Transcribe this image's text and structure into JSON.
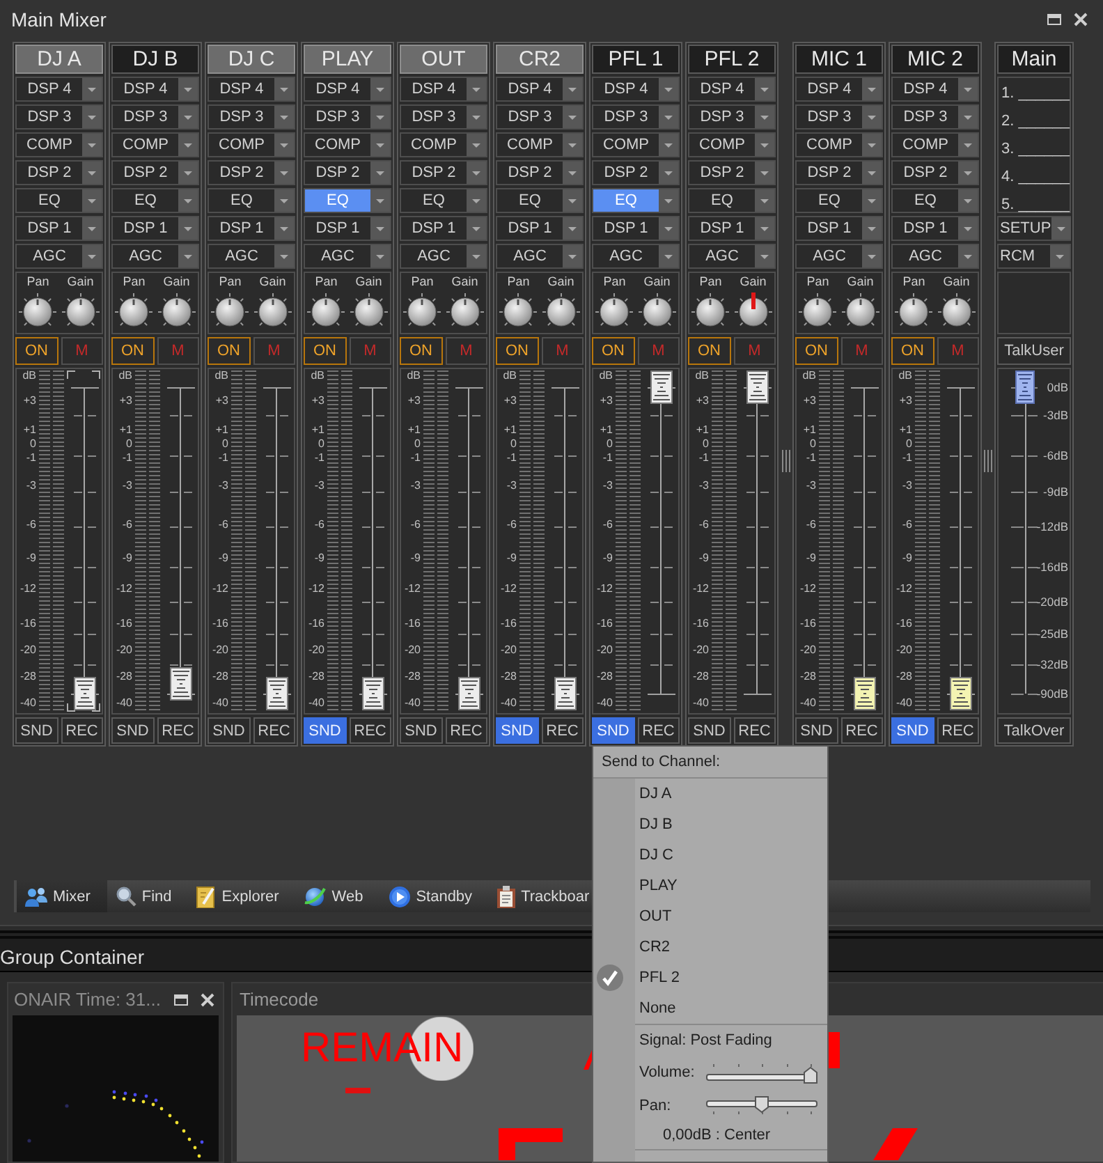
{
  "window": {
    "title": "Main Mixer"
  },
  "groups": [
    {
      "channels": [
        {
          "name": "DJ A",
          "kind": "line",
          "lit": true,
          "slots": [
            {
              "label": "DSP 4",
              "active": false
            },
            {
              "label": "DSP 3",
              "active": false
            },
            {
              "label": "COMP",
              "active": false
            },
            {
              "label": "DSP 2",
              "active": false
            },
            {
              "label": "EQ",
              "active": false
            },
            {
              "label": "DSP 1",
              "active": false
            },
            {
              "label": "AGC",
              "active": false
            }
          ],
          "knobs": [
            {
              "label": "Pan",
              "level": 0.5,
              "highlighted": false
            },
            {
              "label": "Gain",
              "level": 0.5,
              "highlighted": false
            }
          ],
          "on_label": "ON",
          "mute_label": "M",
          "scale": [
            "dB",
            "+3",
            "+1",
            "0",
            "-1",
            "-3",
            "-6",
            "-9",
            "-12",
            "-16",
            "-20",
            "-28",
            "-40"
          ],
          "fader": {
            "level": 0,
            "focused": true
          },
          "send": {
            "label": "SND",
            "on": false
          },
          "rec_label": "REC"
        },
        {
          "name": "DJ B",
          "kind": "line",
          "lit": false,
          "slots": [
            {
              "label": "DSP 4",
              "active": false
            },
            {
              "label": "DSP 3",
              "active": false
            },
            {
              "label": "COMP",
              "active": false
            },
            {
              "label": "DSP 2",
              "active": false
            },
            {
              "label": "EQ",
              "active": false
            },
            {
              "label": "DSP 1",
              "active": false
            },
            {
              "label": "AGC",
              "active": false
            }
          ],
          "knobs": [
            {
              "label": "Pan",
              "level": 0.5,
              "highlighted": false
            },
            {
              "label": "Gain",
              "level": 0.5,
              "highlighted": false
            }
          ],
          "on_label": "ON",
          "mute_label": "M",
          "scale": [
            "dB",
            "+3",
            "+1",
            "0",
            "-1",
            "-3",
            "-6",
            "-9",
            "-12",
            "-16",
            "-20",
            "-28",
            "-40"
          ],
          "fader": {
            "level": 0.03,
            "focused": false
          },
          "send": {
            "label": "SND",
            "on": false
          },
          "rec_label": "REC"
        },
        {
          "name": "DJ C",
          "kind": "line",
          "lit": true,
          "slots": [
            {
              "label": "DSP 4",
              "active": false
            },
            {
              "label": "DSP 3",
              "active": false
            },
            {
              "label": "COMP",
              "active": false
            },
            {
              "label": "DSP 2",
              "active": false
            },
            {
              "label": "EQ",
              "active": false
            },
            {
              "label": "DSP 1",
              "active": false
            },
            {
              "label": "AGC",
              "active": false
            }
          ],
          "knobs": [
            {
              "label": "Pan",
              "level": 0.5,
              "highlighted": false
            },
            {
              "label": "Gain",
              "level": 0.5,
              "highlighted": false
            }
          ],
          "on_label": "ON",
          "mute_label": "M",
          "scale": [
            "dB",
            "+3",
            "+1",
            "0",
            "-1",
            "-3",
            "-6",
            "-9",
            "-12",
            "-16",
            "-20",
            "-28",
            "-40"
          ],
          "fader": {
            "level": 0,
            "focused": false
          },
          "send": {
            "label": "SND",
            "on": false
          },
          "rec_label": "REC"
        },
        {
          "name": "PLAY",
          "kind": "line",
          "lit": true,
          "slots": [
            {
              "label": "DSP 4",
              "active": false
            },
            {
              "label": "DSP 3",
              "active": false
            },
            {
              "label": "COMP",
              "active": false
            },
            {
              "label": "DSP 2",
              "active": false
            },
            {
              "label": "EQ",
              "active": true
            },
            {
              "label": "DSP 1",
              "active": false
            },
            {
              "label": "AGC",
              "active": false
            }
          ],
          "knobs": [
            {
              "label": "Pan",
              "level": 0.5,
              "highlighted": false
            },
            {
              "label": "Gain",
              "level": 0.5,
              "highlighted": false
            }
          ],
          "on_label": "ON",
          "mute_label": "M",
          "scale": [
            "dB",
            "+3",
            "+1",
            "0",
            "-1",
            "-3",
            "-6",
            "-9",
            "-12",
            "-16",
            "-20",
            "-28",
            "-40"
          ],
          "fader": {
            "level": 0,
            "focused": false
          },
          "send": {
            "label": "SND",
            "on": true
          },
          "rec_label": "REC"
        },
        {
          "name": "OUT",
          "kind": "line",
          "lit": true,
          "slots": [
            {
              "label": "DSP 4",
              "active": false
            },
            {
              "label": "DSP 3",
              "active": false
            },
            {
              "label": "COMP",
              "active": false
            },
            {
              "label": "DSP 2",
              "active": false
            },
            {
              "label": "EQ",
              "active": false
            },
            {
              "label": "DSP 1",
              "active": false
            },
            {
              "label": "AGC",
              "active": false
            }
          ],
          "knobs": [
            {
              "label": "Pan",
              "level": 0.5,
              "highlighted": false
            },
            {
              "label": "Gain",
              "level": 0.5,
              "highlighted": false
            }
          ],
          "on_label": "ON",
          "mute_label": "M",
          "scale": [
            "dB",
            "+3",
            "+1",
            "0",
            "-1",
            "-3",
            "-6",
            "-9",
            "-12",
            "-16",
            "-20",
            "-28",
            "-40"
          ],
          "fader": {
            "level": 0,
            "focused": false
          },
          "send": {
            "label": "SND",
            "on": false
          },
          "rec_label": "REC"
        },
        {
          "name": "CR2",
          "kind": "line",
          "lit": true,
          "slots": [
            {
              "label": "DSP 4",
              "active": false
            },
            {
              "label": "DSP 3",
              "active": false
            },
            {
              "label": "COMP",
              "active": false
            },
            {
              "label": "DSP 2",
              "active": false
            },
            {
              "label": "EQ",
              "active": false
            },
            {
              "label": "DSP 1",
              "active": false
            },
            {
              "label": "AGC",
              "active": false
            }
          ],
          "knobs": [
            {
              "label": "Pan",
              "level": 0.5,
              "highlighted": false
            },
            {
              "label": "Gain",
              "level": 0.5,
              "highlighted": false
            }
          ],
          "on_label": "ON",
          "mute_label": "M",
          "scale": [
            "dB",
            "+3",
            "+1",
            "0",
            "-1",
            "-3",
            "-6",
            "-9",
            "-12",
            "-16",
            "-20",
            "-28",
            "-40"
          ],
          "fader": {
            "level": 0,
            "focused": false
          },
          "send": {
            "label": "SND",
            "on": true
          },
          "rec_label": "REC"
        },
        {
          "name": "PFL 1",
          "kind": "line",
          "lit": false,
          "slots": [
            {
              "label": "DSP 4",
              "active": false
            },
            {
              "label": "DSP 3",
              "active": false
            },
            {
              "label": "COMP",
              "active": false
            },
            {
              "label": "DSP 2",
              "active": false
            },
            {
              "label": "EQ",
              "active": true
            },
            {
              "label": "DSP 1",
              "active": false
            },
            {
              "label": "AGC",
              "active": false
            }
          ],
          "knobs": [
            {
              "label": "Pan",
              "level": 0.5,
              "highlighted": false
            },
            {
              "label": "Gain",
              "level": 0.5,
              "highlighted": false
            }
          ],
          "on_label": "ON",
          "mute_label": "M",
          "scale": [
            "dB",
            "+3",
            "+1",
            "0",
            "-1",
            "-3",
            "-6",
            "-9",
            "-12",
            "-16",
            "-20",
            "-28",
            "-40"
          ],
          "fader": {
            "level": 1,
            "focused": false
          },
          "send": {
            "label": "SND",
            "on": true
          },
          "rec_label": "REC"
        },
        {
          "name": "PFL 2",
          "kind": "line",
          "lit": false,
          "slots": [
            {
              "label": "DSP 4",
              "active": false
            },
            {
              "label": "DSP 3",
              "active": false
            },
            {
              "label": "COMP",
              "active": false
            },
            {
              "label": "DSP 2",
              "active": false
            },
            {
              "label": "EQ",
              "active": false
            },
            {
              "label": "DSP 1",
              "active": false
            },
            {
              "label": "AGC",
              "active": false
            }
          ],
          "knobs": [
            {
              "label": "Pan",
              "level": 0.5,
              "highlighted": false
            },
            {
              "label": "Gain",
              "level": 0.5,
              "highlighted": true
            }
          ],
          "on_label": "ON",
          "mute_label": "M",
          "scale": [
            "dB",
            "+3",
            "+1",
            "0",
            "-1",
            "-3",
            "-6",
            "-9",
            "-12",
            "-16",
            "-20",
            "-28",
            "-40"
          ],
          "fader": {
            "level": 1,
            "focused": false
          },
          "send": {
            "label": "SND",
            "on": false
          },
          "rec_label": "REC"
        }
      ]
    },
    {
      "channels": [
        {
          "name": "MIC 1",
          "kind": "mic",
          "lit": false,
          "slots": [
            {
              "label": "DSP 4",
              "active": false
            },
            {
              "label": "DSP 3",
              "active": false
            },
            {
              "label": "COMP",
              "active": false
            },
            {
              "label": "DSP 2",
              "active": false
            },
            {
              "label": "EQ",
              "active": false
            },
            {
              "label": "DSP 1",
              "active": false
            },
            {
              "label": "AGC",
              "active": false
            }
          ],
          "knobs": [
            {
              "label": "Pan",
              "level": 0.5,
              "highlighted": false
            },
            {
              "label": "Gain",
              "level": 0.5,
              "highlighted": false
            }
          ],
          "on_label": "ON",
          "mute_label": "M",
          "scale": [
            "dB",
            "+3",
            "+1",
            "0",
            "-1",
            "-3",
            "-6",
            "-9",
            "-12",
            "-16",
            "-20",
            "-28",
            "-40"
          ],
          "fader": {
            "level": 0,
            "focused": false
          },
          "send": {
            "label": "SND",
            "on": false
          },
          "rec_label": "REC"
        },
        {
          "name": "MIC 2",
          "kind": "mic",
          "lit": false,
          "slots": [
            {
              "label": "DSP 4",
              "active": false
            },
            {
              "label": "DSP 3",
              "active": false
            },
            {
              "label": "COMP",
              "active": false
            },
            {
              "label": "DSP 2",
              "active": false
            },
            {
              "label": "EQ",
              "active": false
            },
            {
              "label": "DSP 1",
              "active": false
            },
            {
              "label": "AGC",
              "active": false
            }
          ],
          "knobs": [
            {
              "label": "Pan",
              "level": 0.5,
              "highlighted": false
            },
            {
              "label": "Gain",
              "level": 0.5,
              "highlighted": false
            }
          ],
          "on_label": "ON",
          "mute_label": "M",
          "scale": [
            "dB",
            "+3",
            "+1",
            "0",
            "-1",
            "-3",
            "-6",
            "-9",
            "-12",
            "-16",
            "-20",
            "-28",
            "-40"
          ],
          "fader": {
            "level": 0,
            "focused": false
          },
          "send": {
            "label": "SND",
            "on": true
          },
          "rec_label": "REC"
        }
      ]
    }
  ],
  "main": {
    "name": "Main",
    "lines": [
      "1. ______",
      "2. ______",
      "3. ______",
      "4. ______",
      "5. ______"
    ],
    "selects": [
      "SETUP",
      "RCM"
    ],
    "talk_user": "TalkUser",
    "scale": [
      "0dB",
      "-3dB",
      "-6dB",
      "-9dB",
      "-12dB",
      "-16dB",
      "-20dB",
      "-25dB",
      "-32dB",
      "-90dB"
    ],
    "fader": {
      "level": 1
    },
    "talk_over": "TalkOver"
  },
  "tabs": [
    {
      "label": "Mixer",
      "selected": true
    },
    {
      "label": "Find",
      "selected": false
    },
    {
      "label": "Explorer",
      "selected": false
    },
    {
      "label": "Web",
      "selected": false
    },
    {
      "label": "Standby",
      "selected": false
    },
    {
      "label": "Trackboar",
      "selected": false
    }
  ],
  "group_container": {
    "title": "Group Container",
    "onair": {
      "title": "ONAIR Time: 31..."
    },
    "timecode": {
      "title": "Timecode",
      "label": "REMAIN"
    }
  },
  "menu": {
    "header": "Send to Channel:",
    "items": [
      {
        "label": "DJ A",
        "checked": false
      },
      {
        "label": "DJ B",
        "checked": false
      },
      {
        "label": "DJ C",
        "checked": false
      },
      {
        "label": "PLAY",
        "checked": false
      },
      {
        "label": "OUT",
        "checked": false
      },
      {
        "label": "CR2",
        "checked": false
      },
      {
        "label": "PFL 2",
        "checked": true
      },
      {
        "label": "None",
        "checked": false
      }
    ],
    "signal": "Signal: Post Fading",
    "sliders": [
      {
        "label": "Volume:",
        "level": 1
      },
      {
        "label": "Pan:",
        "level": 0.5
      }
    ],
    "readout": "0,00dB : Center"
  }
}
